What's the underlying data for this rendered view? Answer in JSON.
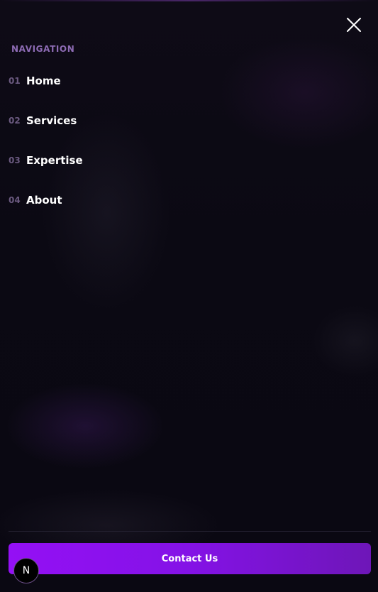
{
  "menu": {
    "close_icon": "close-icon",
    "section_label": "NAVIGATION",
    "items": [
      {
        "num": "01",
        "label": "Home"
      },
      {
        "num": "02",
        "label": "Services"
      },
      {
        "num": "03",
        "label": "Expertise"
      },
      {
        "num": "04",
        "label": "About"
      }
    ]
  },
  "footer": {
    "contact_label": "Contact Us",
    "badge_letter": "N"
  },
  "colors": {
    "background": "#0b0913",
    "accent": "#9410f5",
    "section_label": "#8d6bb4",
    "number": "#6b5a80"
  }
}
